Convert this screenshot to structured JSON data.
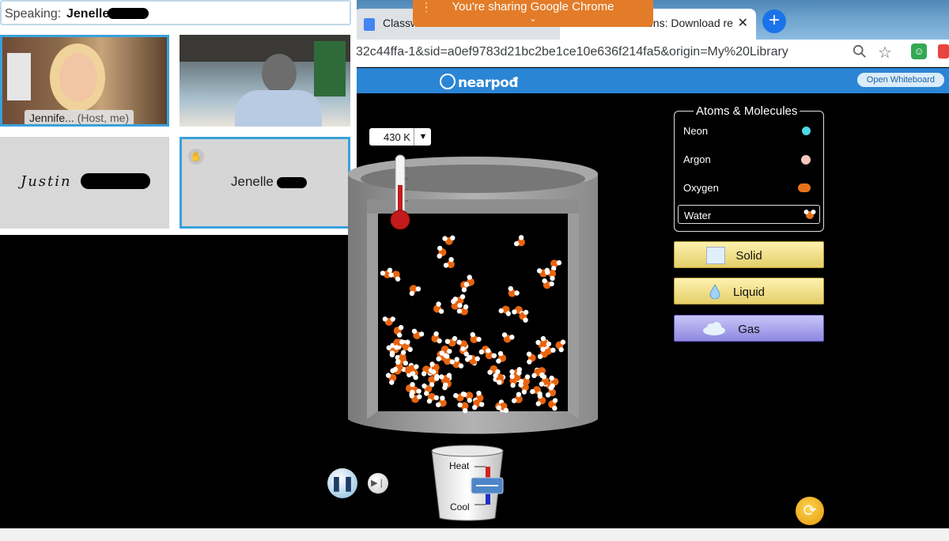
{
  "browser": {
    "tabs": [
      {
        "label": "Classw",
        "active": false
      },
      {
        "label": "ons: Download re",
        "active": true
      }
    ],
    "url": "32c44ffa-1&sid=a0ef9783d21bc2be1ce10e636f214fa5&origin=My%20Library",
    "new_tab_symbol": "+",
    "close_symbol": "✕"
  },
  "share_banner": {
    "text": "You're sharing Google Chrome",
    "chevron": "⌄"
  },
  "nearpod": {
    "logo": "nearpod",
    "whiteboard_button": "Open Whiteboard"
  },
  "meeting": {
    "speaking_label": "Speaking:",
    "speaking_name": "Jenelle",
    "participants": [
      {
        "label": "Jennife...",
        "role": "(Host, me)"
      },
      {
        "label": "Justin"
      },
      {
        "label": "Jenelle",
        "hand_raised": true
      }
    ]
  },
  "simulation": {
    "temperature": "430 K",
    "dropdown_symbol": "▼",
    "atoms_panel_title": "Atoms & Molecules",
    "atoms": [
      {
        "label": "Neon",
        "color": "#4fd8e8"
      },
      {
        "label": "Argon",
        "color": "#f5c6c0"
      },
      {
        "label": "Oxygen",
        "color": "#e8731a"
      },
      {
        "label": "Water",
        "color": "#e8731a",
        "selected": true
      }
    ],
    "phase_buttons": [
      "Solid",
      "Liquid",
      "Gas"
    ],
    "heat_label": "Heat",
    "cool_label": "Cool",
    "pause_symbol": "❚❚",
    "step_symbol": "▶❘",
    "reset_symbol": "⟳"
  },
  "colors": {
    "accent_blue": "#2b85d5",
    "share_orange": "#e37c28",
    "molecule_orange": "#e8640f",
    "molecule_white": "#ffffff"
  }
}
